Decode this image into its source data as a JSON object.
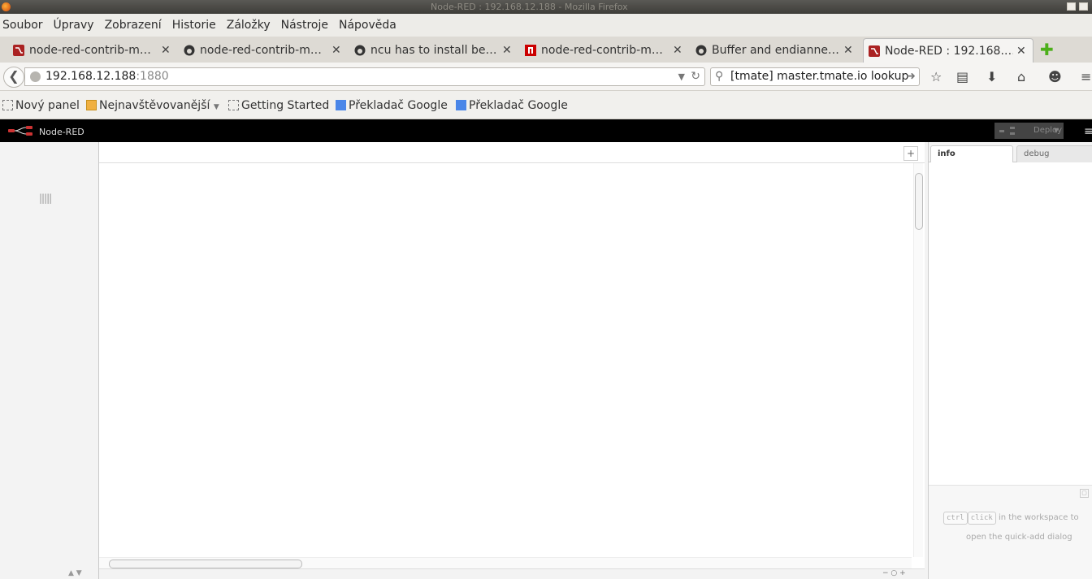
{
  "window": {
    "title": "Node-RED : 192.168.12.188 - Mozilla Firefox"
  },
  "menubar": {
    "items": [
      "Soubor",
      "Úpravy",
      "Zobrazení",
      "Historie",
      "Záložky",
      "Nástroje",
      "Nápověda"
    ]
  },
  "tabs": [
    {
      "label": "node-red-contrib-m…",
      "icon": "node-red-icon"
    },
    {
      "label": "node-red-contrib-m…",
      "icon": "github-icon"
    },
    {
      "label": "ncu has to install be…",
      "icon": "github-icon"
    },
    {
      "label": "node-red-contrib-m…",
      "icon": "npm-icon"
    },
    {
      "label": "Buffer and endianne…",
      "icon": "github-icon"
    },
    {
      "label": "Node-RED : 192.168.…",
      "icon": "node-red-icon",
      "active": true
    }
  ],
  "nav": {
    "url_host": "192.168.12.188",
    "url_port": ":1880",
    "search_text": "[tmate] master.tmate.io lookup"
  },
  "bookmarks": [
    {
      "label": "Nový panel",
      "icon": "page-icon"
    },
    {
      "label": "Nejnavštěvovanější",
      "icon": "folder-icon",
      "dropdown": true
    },
    {
      "label": "Getting Started",
      "icon": "page-icon"
    },
    {
      "label": "Překladač Google",
      "icon": "google-translate-icon"
    },
    {
      "label": "Překladač Google",
      "icon": "google-translate-icon"
    }
  ],
  "nodered": {
    "title": "Node-RED",
    "deploy_label": "Deploy",
    "sidebar_tabs": [
      "info",
      "debug"
    ],
    "help": {
      "key1": "ctrl",
      "key2": "click",
      "text1": "in the workspace to",
      "text2": "open the quick-add dialog"
    }
  },
  "colors": {
    "header_bg": "#000000",
    "accent_red": "#aa2222",
    "tab_bar_bg": "#dddad4"
  }
}
